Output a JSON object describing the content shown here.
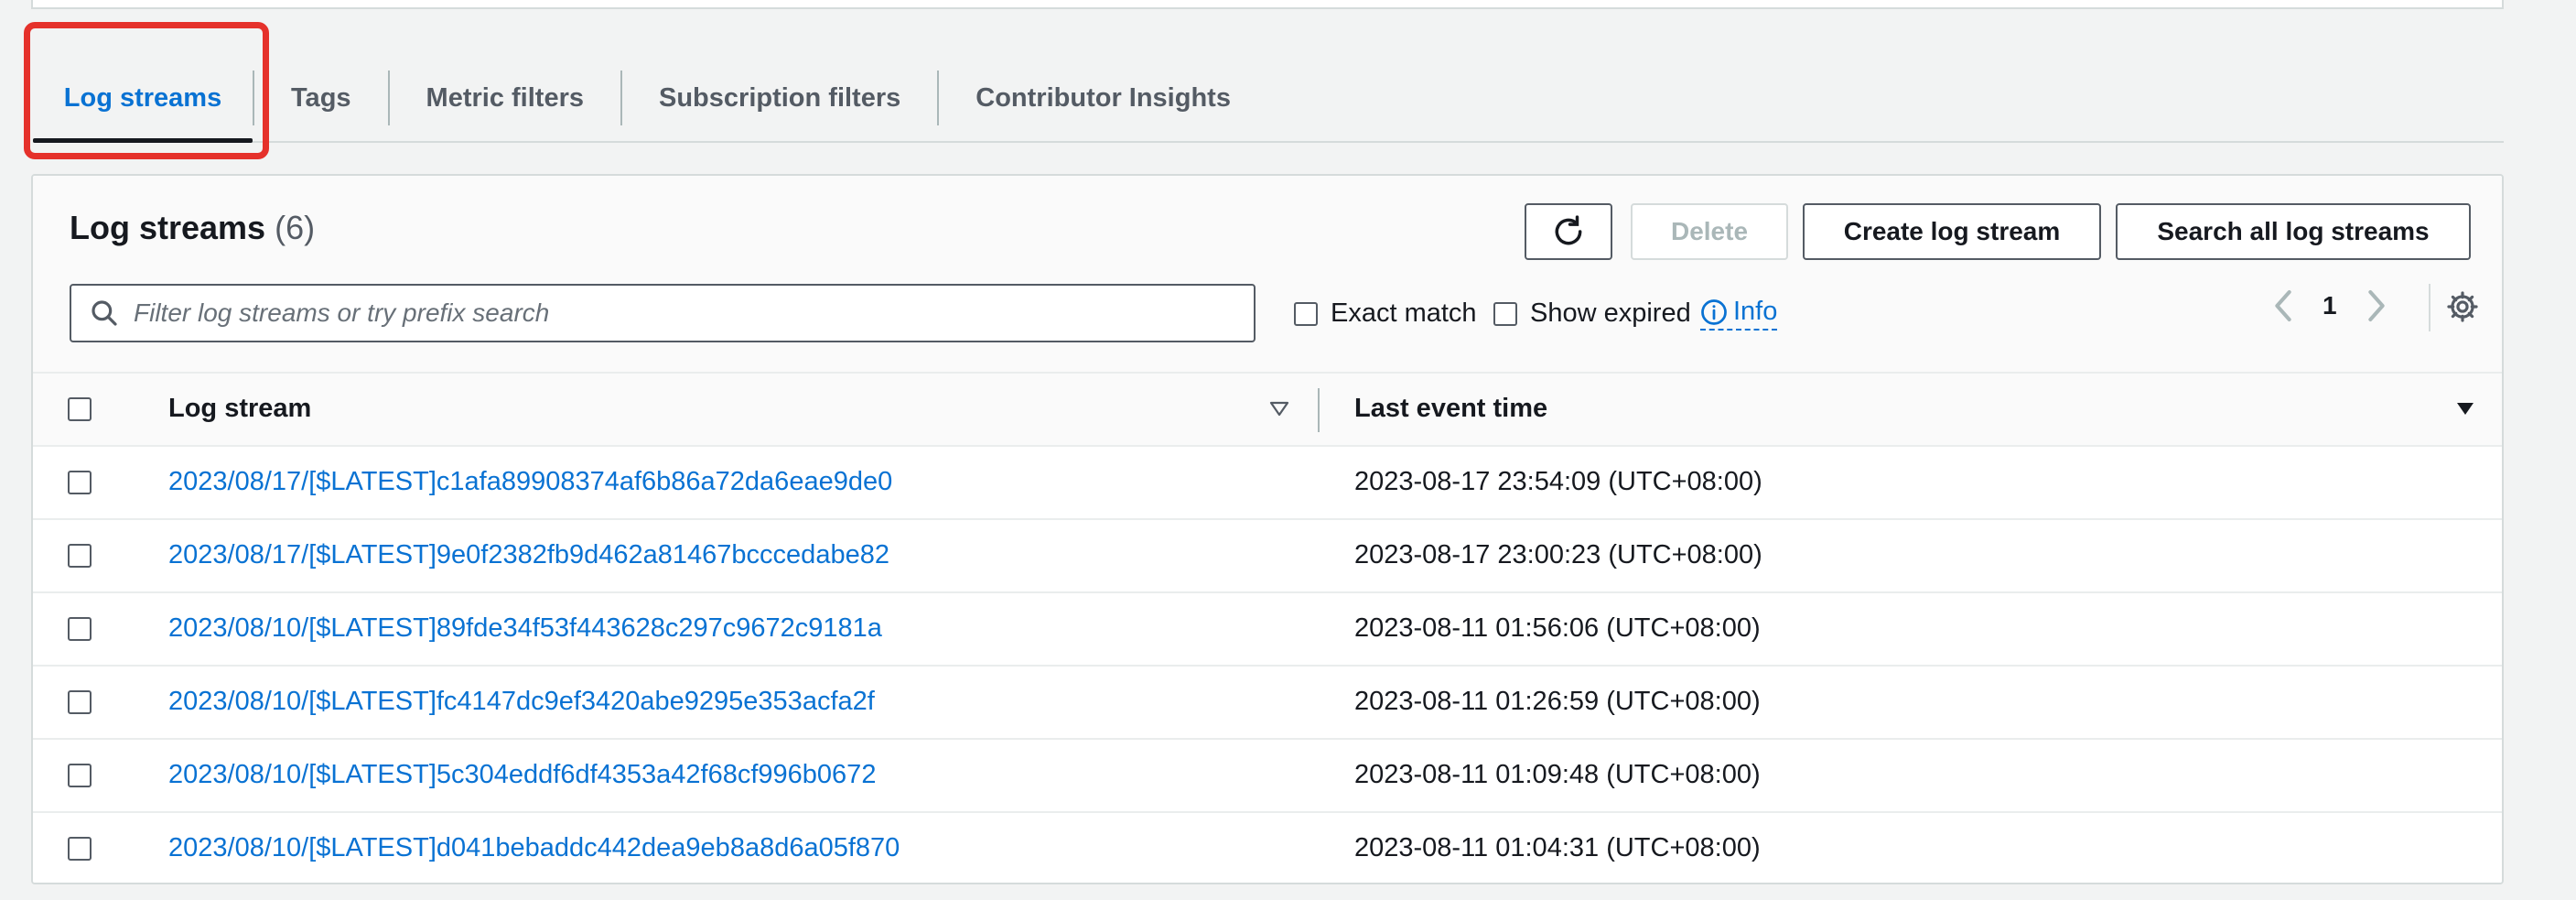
{
  "tabs": [
    {
      "label": "Log streams",
      "active": true
    },
    {
      "label": "Tags"
    },
    {
      "label": "Metric filters"
    },
    {
      "label": "Subscription filters"
    },
    {
      "label": "Contributor Insights"
    }
  ],
  "panel": {
    "title": "Log streams",
    "count": "(6)",
    "buttons": {
      "delete": "Delete",
      "create": "Create log stream",
      "search_all": "Search all log streams"
    },
    "search": {
      "placeholder": "Filter log streams or try prefix search",
      "value": ""
    },
    "exact_match": "Exact match",
    "show_expired": "Show expired",
    "info": "Info",
    "page": "1"
  },
  "table": {
    "columns": [
      "Log stream",
      "Last event time"
    ],
    "rows": [
      {
        "name": "2023/08/17/[$LATEST]c1afa89908374af6b86a72da6eae9de0",
        "time": "2023-08-17 23:54:09 (UTC+08:00)"
      },
      {
        "name": "2023/08/17/[$LATEST]9e0f2382fb9d462a81467bcccedabe82",
        "time": "2023-08-17 23:00:23 (UTC+08:00)"
      },
      {
        "name": "2023/08/10/[$LATEST]89fde34f53f443628c297c9672c9181a",
        "time": "2023-08-11 01:56:06 (UTC+08:00)"
      },
      {
        "name": "2023/08/10/[$LATEST]fc4147dc9ef3420abe9295e353acfa2f",
        "time": "2023-08-11 01:26:59 (UTC+08:00)"
      },
      {
        "name": "2023/08/10/[$LATEST]5c304eddf6df4353a42f68cf996b0672",
        "time": "2023-08-11 01:09:48 (UTC+08:00)"
      },
      {
        "name": "2023/08/10/[$LATEST]d041bebaddc442dea9eb8a8d6a05f870",
        "time": "2023-08-11 01:04:31 (UTC+08:00)"
      }
    ]
  },
  "colors": {
    "link": "#0972d3",
    "highlight": "#e5312b",
    "text": "#16191f"
  }
}
